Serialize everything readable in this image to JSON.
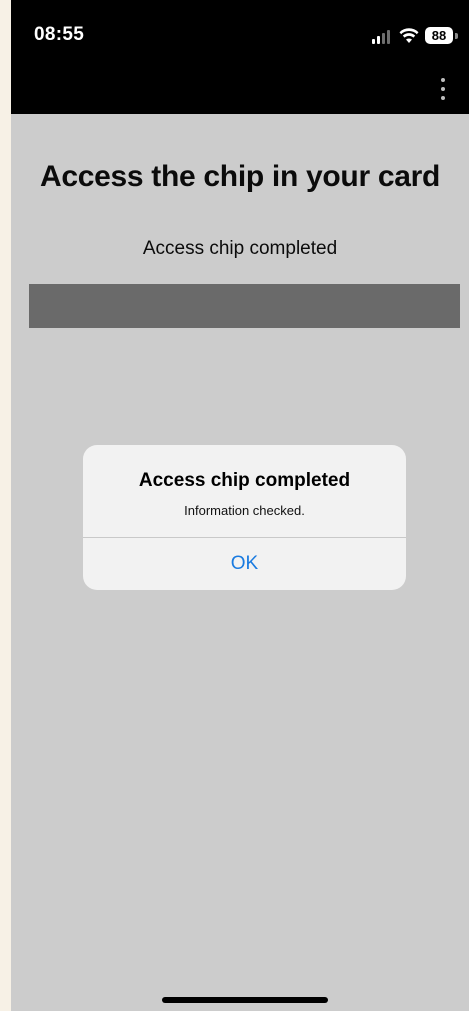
{
  "status_bar": {
    "time": "08:55",
    "battery_level": "88",
    "signal_icon": "cellular-signal-icon",
    "wifi_icon": "wifi-icon"
  },
  "app_bar": {
    "menu_icon": "more-vertical-icon"
  },
  "main": {
    "title": "Access the chip in your card",
    "status_text": "Access chip completed",
    "progress": 1.0
  },
  "alert": {
    "title": "Access chip completed",
    "message": "Information checked.",
    "ok_label": "OK"
  },
  "colors": {
    "background": "#cccccc",
    "status_bar": "#000000",
    "progress_bar": "#6a6a6a",
    "alert_background": "#f2f2f2",
    "alert_button": "#1a7be0"
  }
}
